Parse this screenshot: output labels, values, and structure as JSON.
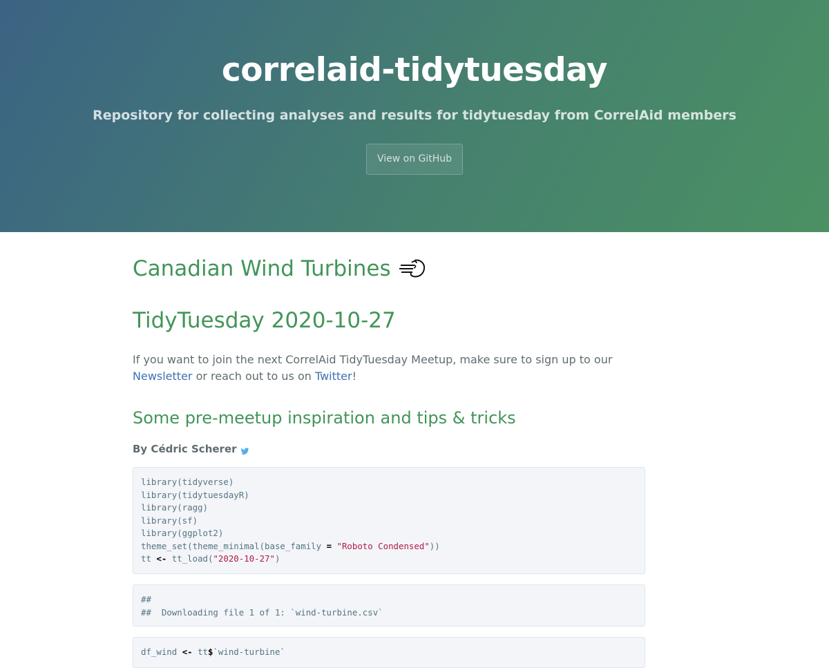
{
  "header": {
    "title": "correlaid-tidytuesday",
    "tagline": "Repository for collecting analyses and results for tidytuesday from CorrelAid members",
    "github_button": "View on GitHub"
  },
  "content": {
    "heading1": "Canadian Wind Turbines",
    "heading1_icon": "wind-face-icon",
    "heading2": "TidyTuesday 2020-10-27",
    "intro": {
      "text_before": "If you want to join the next CorrelAid TidyTuesday Meetup, make sure to sign up to our ",
      "newsletter_link": "Newsletter",
      "text_middle": " or reach out to us on ",
      "twitter_link": "Twitter",
      "text_after": "!"
    },
    "subheading": "Some pre-meetup inspiration and tips & tricks",
    "author": "By Cédric Scherer",
    "author_icon": "twitter-bird-icon",
    "code_block_1": {
      "lines": [
        "library(tidyverse)",
        "library(tidytuesdayR)",
        "library(ragg)",
        "library(sf)",
        "library(ggplot2)"
      ],
      "theme_prefix": "theme_set(theme_minimal(base_family ",
      "theme_eq": "=",
      "theme_space": " ",
      "theme_string": "\"Roboto Condensed\"",
      "theme_suffix": "))",
      "load_prefix": "tt ",
      "load_op": "<-",
      "load_mid": " tt_load(",
      "load_string": "\"2020-10-27\"",
      "load_suffix": ")"
    },
    "code_block_2": {
      "line1": "##",
      "line2": "##  Downloading file 1 of 1: `wind-turbine.csv`"
    },
    "code_block_3": {
      "prefix": "df_wind ",
      "op": "<-",
      "mid": " tt",
      "dollar": "$",
      "suffix": "`wind-turbine`"
    }
  },
  "colors": {
    "heading": "#429559",
    "link": "#3d6fb3",
    "header_gradient_start": "#3b6384",
    "header_gradient_end": "#4a9163",
    "string": "#b01b46"
  }
}
